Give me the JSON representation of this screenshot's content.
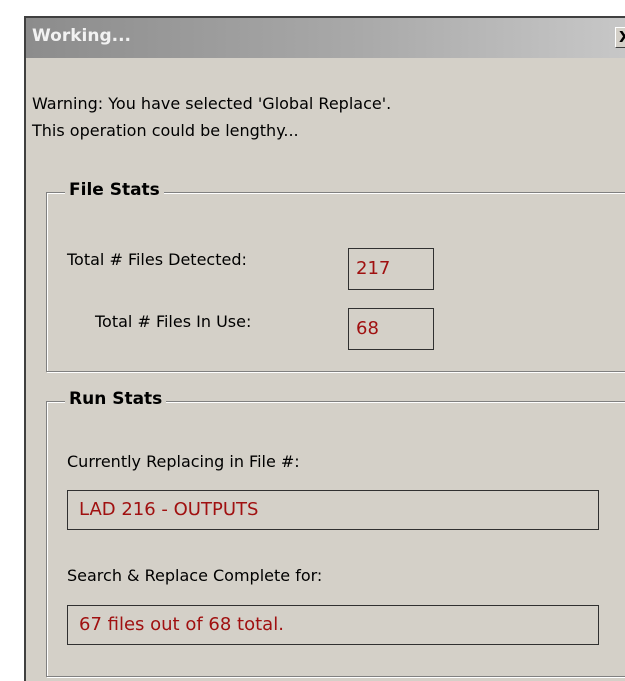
{
  "window": {
    "title": "Working...",
    "close_glyph": "X"
  },
  "warning": {
    "line1": "Warning:  You have selected 'Global Replace'.",
    "line2": "This operation could be lengthy..."
  },
  "file_stats": {
    "title": "File Stats",
    "detected_label": "Total # Files Detected:",
    "detected_value": "217",
    "in_use_label": "Total # Files In Use:",
    "in_use_value": "68"
  },
  "run_stats": {
    "title": "Run Stats",
    "current_label": "Currently Replacing in File #:",
    "current_value": "LAD 216 - OUTPUTS",
    "complete_label": "Search & Replace Complete for:",
    "complete_value": "67 files out of 68 total."
  },
  "colors": {
    "dialog_bg": "#d4d0c8",
    "value_text": "#a01010"
  }
}
